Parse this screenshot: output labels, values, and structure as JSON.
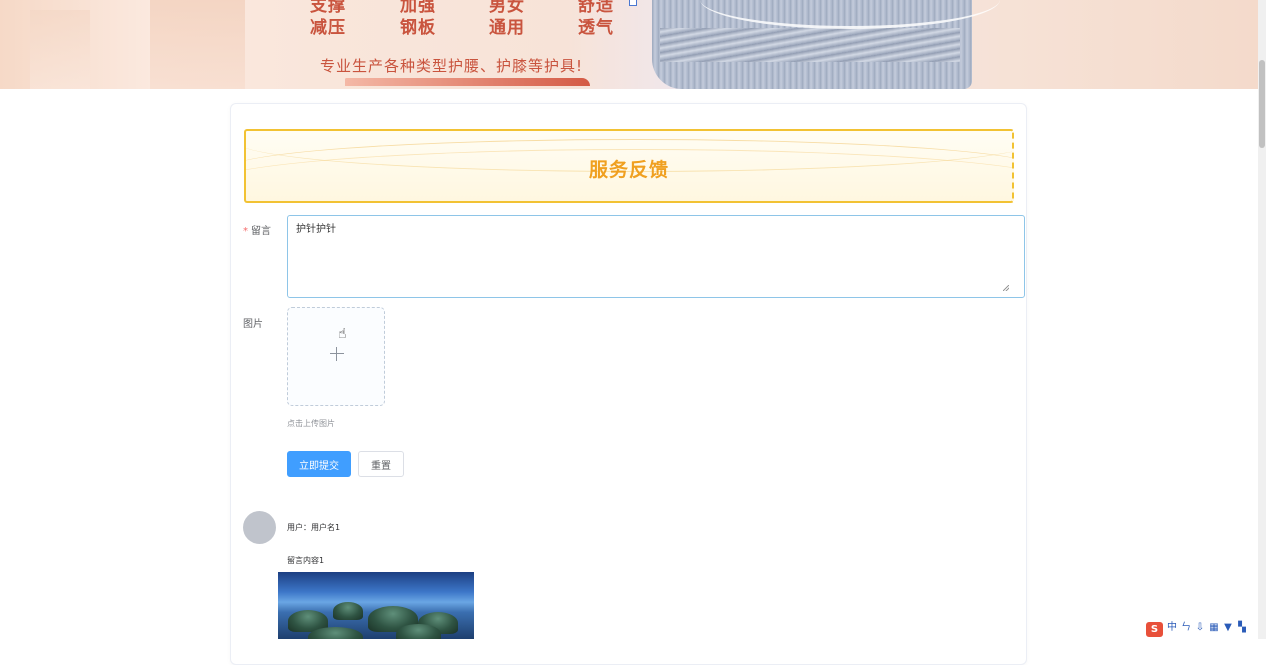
{
  "banner": {
    "features_row1": [
      "支撑",
      "加强",
      "男女",
      "舒适"
    ],
    "features_row2": [
      "减压",
      "钢板",
      "通用",
      "透气"
    ],
    "slogan": "专业生产各种类型护腰、护膝等护具!"
  },
  "section": {
    "title": "服务反馈"
  },
  "form": {
    "message_label": "留言",
    "message_value": "护针护针",
    "image_label": "图片",
    "upload_tip": "点击上传图片",
    "submit_label": "立即提交",
    "reset_label": "重置"
  },
  "comments": [
    {
      "user": "用户：用户名1",
      "content": "留言内容1"
    }
  ],
  "tray": {
    "logo": "S",
    "icons": [
      "中",
      "ㄣ",
      "⇩",
      "▦",
      "▼",
      "▚"
    ]
  },
  "colors": {
    "primary": "#409eff",
    "title": "#f0a020",
    "banner_text": "#c9543e"
  }
}
